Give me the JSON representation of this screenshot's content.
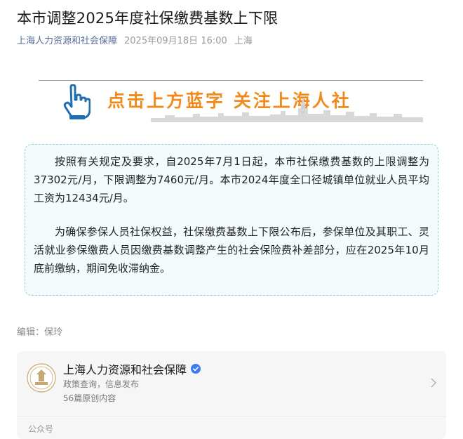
{
  "article": {
    "title": "本市调整2025年度社保缴费基数上下限",
    "account_name": "上海人力资源和社会保障",
    "date": "2025年09月18日 16:00",
    "location": "上海"
  },
  "banner": {
    "slogan": "点击上方蓝字   关注上海人社",
    "hand_icon": "pointing-hand-icon"
  },
  "body": {
    "paragraphs": [
      "按照有关规定及要求，自2025年7月1日起，本市社保缴费基数的上限调整为37302元/月，下限调整为7460元/月。本市2024年度全口径城镇单位就业人员平均工资为12434元/月。",
      "为确保参保人员社保权益，社保缴费基数上下限公布后，参保单位及其职工、灵活就业参保缴费人员因缴费基数调整产生的社会保险费补差部分，应在2025年10月底前缴纳，期间免收滞纳金。"
    ]
  },
  "editor": "编辑：保玲",
  "profile": {
    "name": "上海人力资源和社会保障",
    "description": "政策查询，信息发布",
    "article_count": "56篇原创内容",
    "type_label": "公众号",
    "avatar_icon": "account-logo-icon",
    "verified_icon": "verified-badge-icon",
    "chevron_icon": "chevron-right-icon"
  },
  "colors": {
    "accent_link": "#576b95",
    "slogan_orange": "#f08a1c",
    "hand_blue": "#1f6fb2",
    "card_border": "#8fd3dd",
    "card_bg": "#f3fbfd",
    "verified_blue": "#3f7cf4"
  }
}
